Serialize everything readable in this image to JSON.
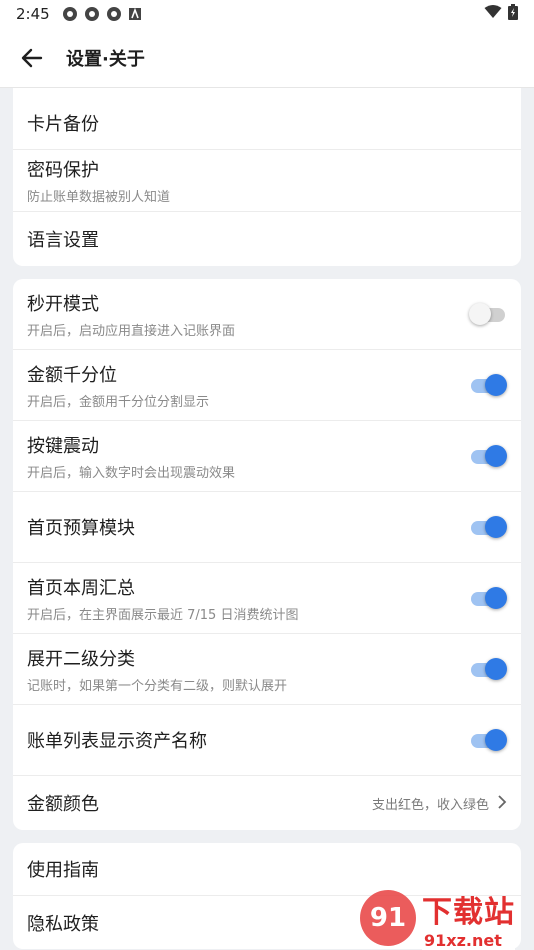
{
  "status_bar": {
    "time": "2:45"
  },
  "app_bar": {
    "title": "设置·关于"
  },
  "group1": [
    {
      "label": "卡片备份",
      "sub": ""
    },
    {
      "label": "密码保护",
      "sub": "防止账单数据被别人知道"
    },
    {
      "label": "语言设置",
      "sub": ""
    }
  ],
  "group2": [
    {
      "label": "秒开模式",
      "sub": "开启后，启动应用直接进入记账界面",
      "toggle": false
    },
    {
      "label": "金额千分位",
      "sub": "开启后，金额用千分位分割显示",
      "toggle": true
    },
    {
      "label": "按键震动",
      "sub": "开启后，输入数字时会出现震动效果",
      "toggle": true
    },
    {
      "label": "首页预算模块",
      "sub": "",
      "toggle": true
    },
    {
      "label": "首页本周汇总",
      "sub": "开启后，在主界面展示最近 7/15 日消费统计图",
      "toggle": true
    },
    {
      "label": "展开二级分类",
      "sub": "记账时，如果第一个分类有二级，则默认展开",
      "toggle": true
    },
    {
      "label": "账单列表显示资产名称",
      "sub": "",
      "toggle": true
    }
  ],
  "amount_color": {
    "label": "金额颜色",
    "value": "支出红色，收入绿色"
  },
  "group3": [
    {
      "label": "使用指南"
    },
    {
      "label": "隐私政策"
    }
  ],
  "watermark": {
    "logo": "91",
    "cn": "下载站",
    "url": "91xz.net"
  },
  "colors": {
    "accent": "#2f7ae5",
    "track_on": "#9fc3f2",
    "background": "#eef0f3"
  }
}
